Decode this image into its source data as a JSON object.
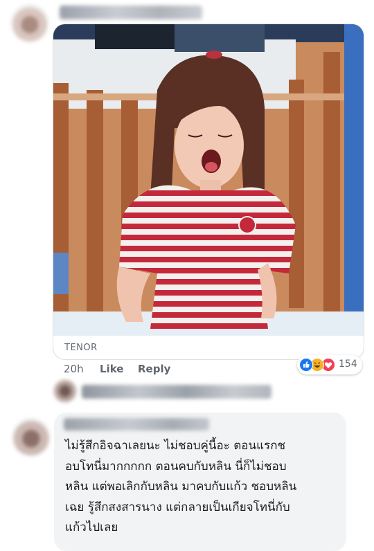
{
  "top_comment": {
    "gif": {
      "provider_label": "TENOR"
    },
    "timestamp": "20h",
    "like_label": "Like",
    "reply_label": "Reply",
    "reactions": {
      "icons": [
        "like-icon",
        "haha-icon",
        "love-icon"
      ],
      "count": "154"
    }
  },
  "second_comment": {
    "text_lines": [
      "ไม่รู้สึกอิจฉาเลยนะ ไม่ชอบคู่นี้อะ  ตอนแรกช",
      "อบโทนี่มากกกกก  ตอนคบกับหลิน นี่ก็ไม่ชอบ",
      "หลิน แต่พอเลิกกับหลิน มาคบกับแก้ว ชอบหลิน",
      "เฉย รู้สึกสงสารนาง แต่กลายเป็นเกียจโทนี่กับ",
      "แก้วไปเลย"
    ]
  },
  "colors": {
    "like_blue": "#1877f2",
    "haha_yellow": "#f7b125",
    "love_red": "#f33e58",
    "meta_gray": "#606770",
    "bubble_bg": "#f2f3f5"
  }
}
